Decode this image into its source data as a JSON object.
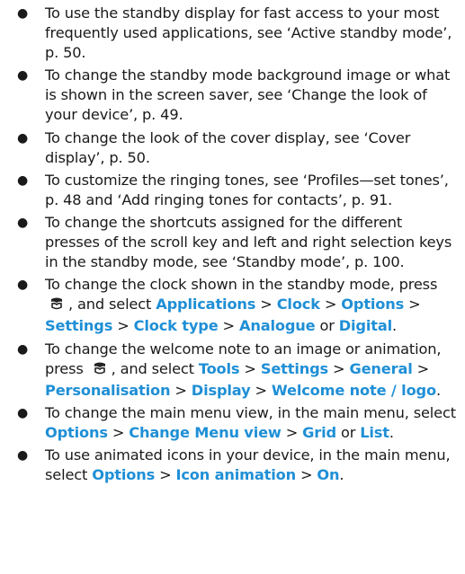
{
  "colors": {
    "text": "#1a1a1a",
    "highlight": "#1f8fd6"
  },
  "icons": {
    "menu_key": "menu-key-icon"
  },
  "items": [
    {
      "text": "To use the standby display for fast access to your most frequently used applications, see ‘Active standby mode’, p. 50."
    },
    {
      "text": "To change the standby mode background image or what is shown in the screen saver, see ‘Change the look of your device’, p. 49."
    },
    {
      "text": "To change the look of the cover display, see ‘Cover display’, p. 50."
    },
    {
      "text": "To customize the ringing tones, see ‘Profiles—set tones’, p. 48 and ‘Add ringing tones for contacts’, p. 91."
    },
    {
      "text": "To change the shortcuts assigned for the different presses of the scroll key and left and right selection keys in the standby mode, see ‘Standby mode’, p. 100."
    },
    {
      "pre": "To change the clock shown in the standby mode, press",
      "mid": ", and select",
      "path": [
        "Applications",
        "Clock",
        "Options",
        "Settings",
        "Clock type",
        "Analogue"
      ],
      "or_word": "or",
      "alt": "Digital",
      "end": "."
    },
    {
      "pre": "To change the welcome note to an image or animation, press",
      "mid": ", and select",
      "path": [
        "Tools",
        "Settings",
        "General",
        "Personalisation",
        "Display",
        "Welcome note / logo"
      ],
      "end": "."
    },
    {
      "pre": "To change the main menu view, in the main menu, select",
      "path": [
        "Options",
        "Change Menu view",
        "Grid"
      ],
      "or_word": "or",
      "alt": "List",
      "end": "."
    },
    {
      "pre": "To use animated icons in your device, in the main menu, select",
      "path": [
        "Options",
        "Icon animation",
        "On"
      ],
      "end": "."
    }
  ]
}
